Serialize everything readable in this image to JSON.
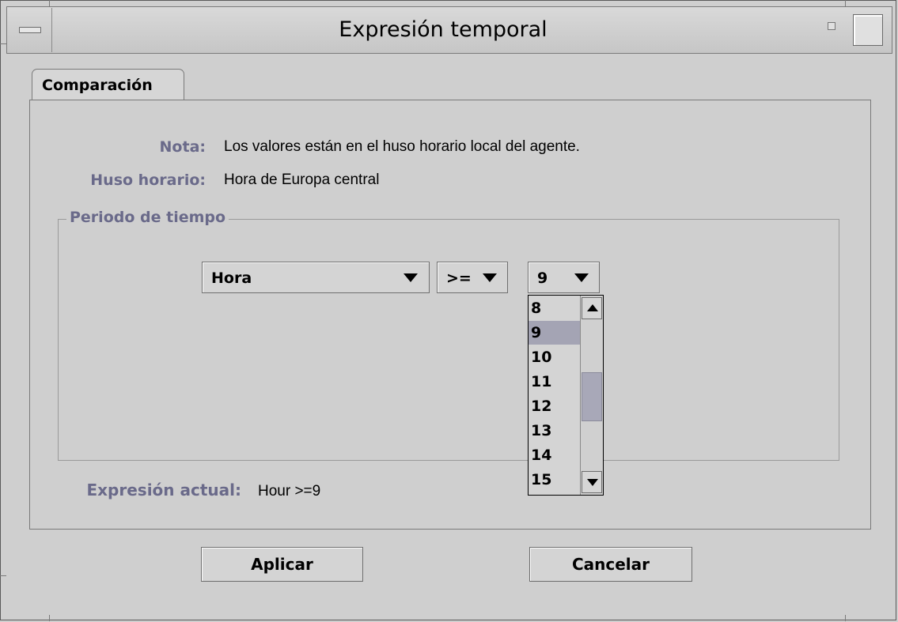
{
  "window": {
    "title": "Expresión temporal"
  },
  "tabs": [
    {
      "label": "Comparación",
      "selected": true
    }
  ],
  "info": {
    "note_label": "Nota:",
    "note_value": "Los valores están en el huso horario local del agente.",
    "timezone_label": "Huso horario:",
    "timezone_value": "Hora de Europa central"
  },
  "period": {
    "legend": "Periodo de tiempo",
    "field_select": {
      "value": "Hora"
    },
    "operator_select": {
      "value": ">="
    },
    "value_select": {
      "value": "9",
      "options_visible": [
        "8",
        "9",
        "10",
        "11",
        "12",
        "13",
        "14",
        "15"
      ],
      "highlighted": "9"
    }
  },
  "expression": {
    "label": "Expresión actual:",
    "value": "Hour >=9"
  },
  "buttons": {
    "apply": "Aplicar",
    "cancel": "Cancelar"
  },
  "colors": {
    "background": "#cfcfcf",
    "label": "#6a6a8a",
    "selection": "#a4a4b4"
  }
}
